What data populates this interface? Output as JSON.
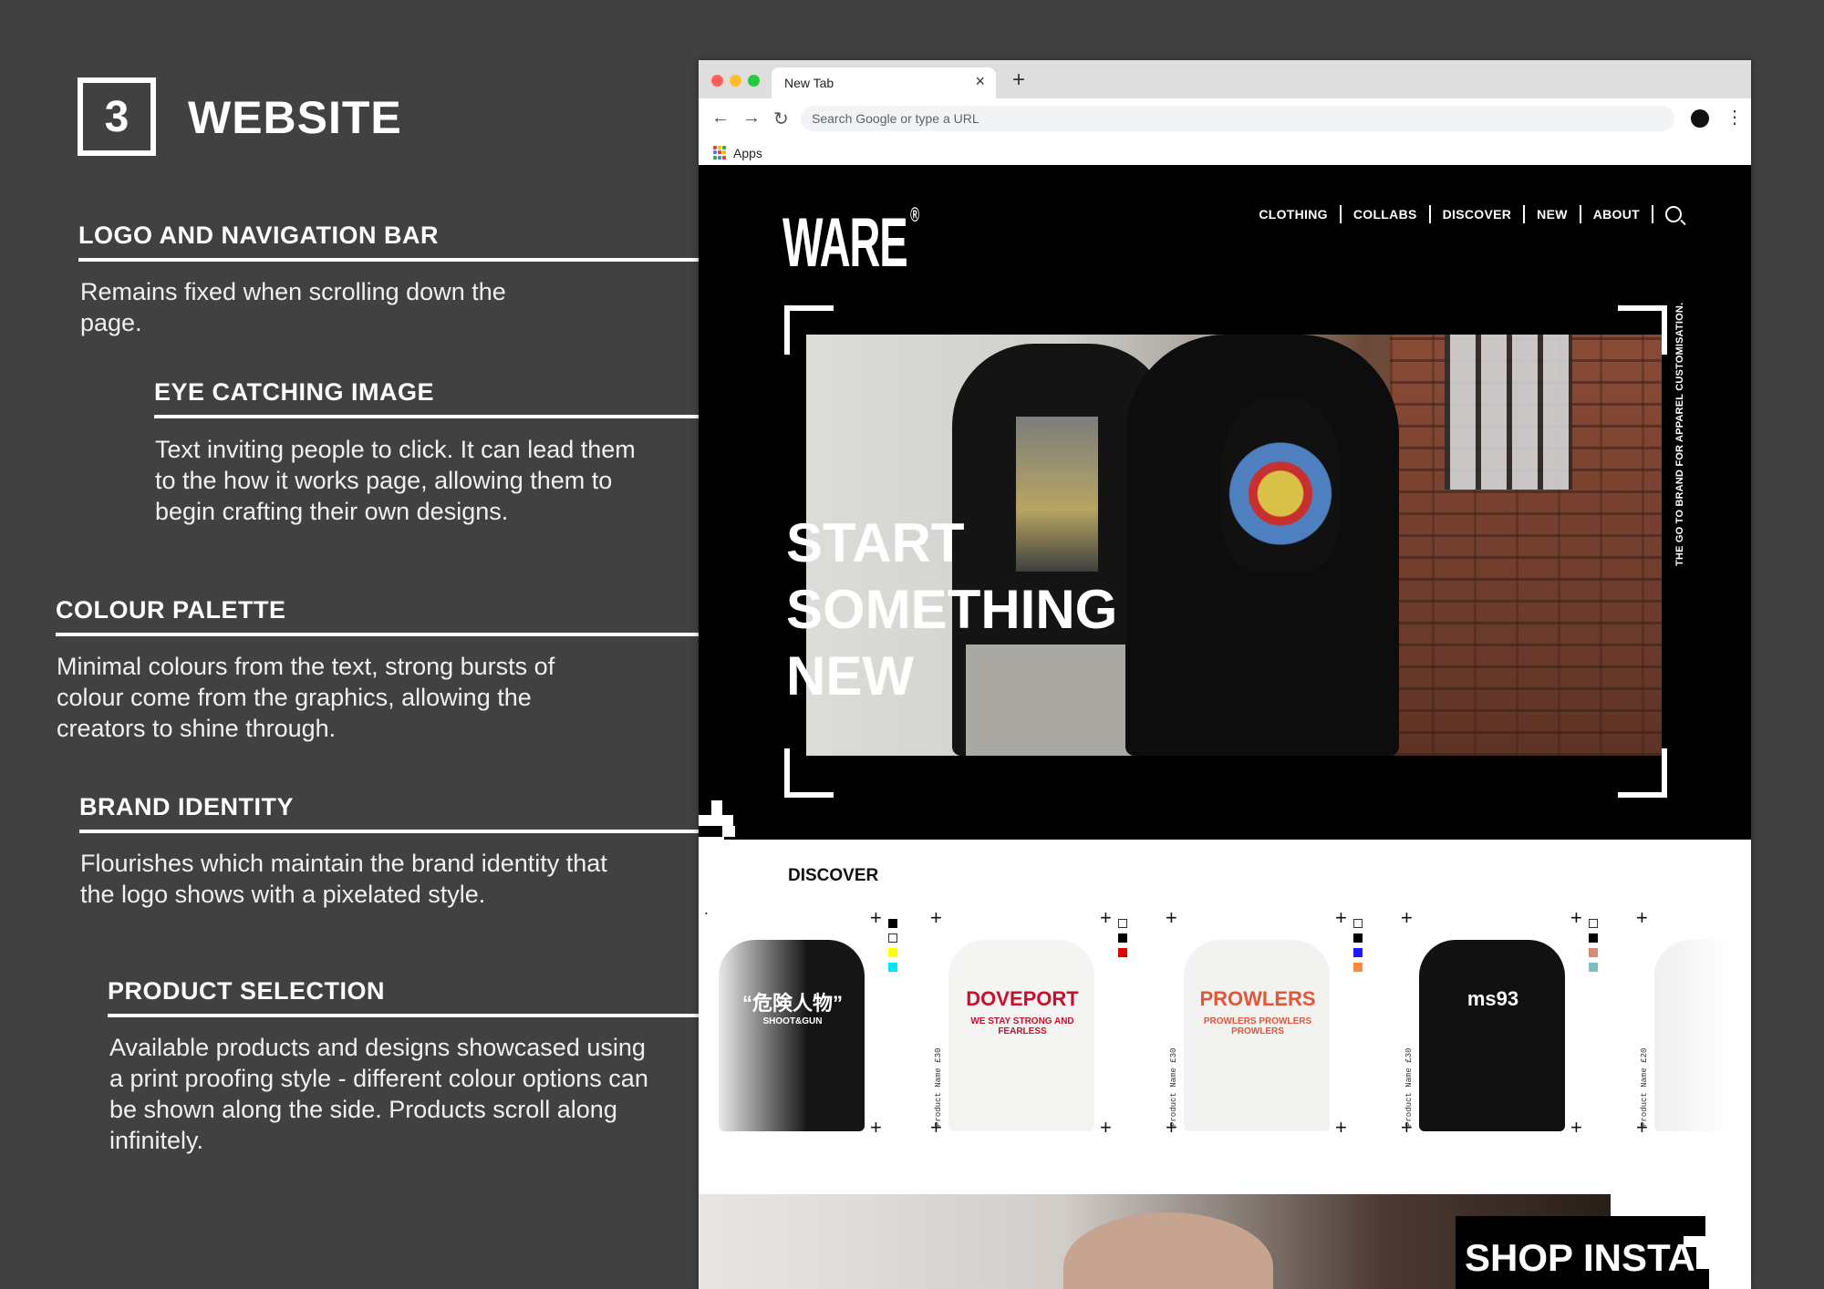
{
  "header": {
    "step_number": "3",
    "title": "WEBSITE"
  },
  "annotations": [
    {
      "heading": "LOGO AND NAVIGATION BAR",
      "body": "Remains fixed when scrolling down the page."
    },
    {
      "heading": "EYE CATCHING IMAGE",
      "body": "Text inviting people to click. It can lead them to the how it works page, allowing them to begin crafting their own designs."
    },
    {
      "heading": "COLOUR PALETTE",
      "body": "Minimal colours from the text, strong bursts of colour come from the graphics, allowing the creators to shine through."
    },
    {
      "heading": "BRAND IDENTITY",
      "body": "Flourishes which maintain the brand identity that the logo shows with a pixelated style."
    },
    {
      "heading": "PRODUCT SELECTION",
      "body": "Available products and designs showcased using a print proofing style - different colour options can be shown along the side. Products scroll along infinitely."
    }
  ],
  "browser": {
    "tab_title": "New Tab",
    "tab_close": "×",
    "new_tab": "+",
    "back": "←",
    "forward": "→",
    "reload": "↻",
    "omnibox_placeholder": "Search Google or type a URL",
    "menu": "⋮",
    "bookmark_apps": "Apps",
    "apps_colors": [
      "#ea4335",
      "#fbbc05",
      "#34a853",
      "#4285f4",
      "#ea4335",
      "#fbbc05",
      "#34a853",
      "#4285f4",
      "#ea4335"
    ]
  },
  "site": {
    "logo": "WARE",
    "logo_mark": "®",
    "nav": [
      "CLOTHING",
      "COLLABS",
      "DISCOVER",
      "NEW",
      "ABOUT"
    ],
    "hero_cta": [
      "START",
      "SOMETHING",
      "NEW"
    ],
    "tagline": "THE GO TO BRAND FOR APPAREL CUSTOMISATION.",
    "discover_title": "DISCOVER",
    "products": [
      {
        "price_label": "",
        "shirt_color": "#151515",
        "print_text": "“危険人物”",
        "print_sub": "SHOOT&GUN",
        "swatches": [
          "#000000",
          "#ffffff",
          "#ffff00",
          "#00e5ff"
        ]
      },
      {
        "price_label": "Product Name £30",
        "shirt_color": "#f4f4f2",
        "print_text": "DOVEPORT",
        "print_sub": "WE STAY STRONG AND FEARLESS",
        "swatches": [
          "#ffffff",
          "#000000",
          "#e00000"
        ]
      },
      {
        "price_label": "Product Name £30",
        "shirt_color": "#f2f2f0",
        "print_text": "PROWLERS",
        "print_sub": "PROWLERS PROWLERS PROWLERS",
        "swatches": [
          "#ffffff",
          "#000000",
          "#1a1aff",
          "#ff8a3d"
        ]
      },
      {
        "price_label": "Product Name £30",
        "shirt_color": "#111111",
        "print_text": "ms93",
        "print_sub": "",
        "swatches": [
          "#ffffff",
          "#000000",
          "#d98c73",
          "#7fbfc4"
        ]
      },
      {
        "price_label": "Product Name £20",
        "shirt_color": "#eeeeee",
        "print_text": "",
        "print_sub": "",
        "swatches": []
      }
    ],
    "crop_mark": "+",
    "shop_insta": "SHOP INSTA"
  }
}
